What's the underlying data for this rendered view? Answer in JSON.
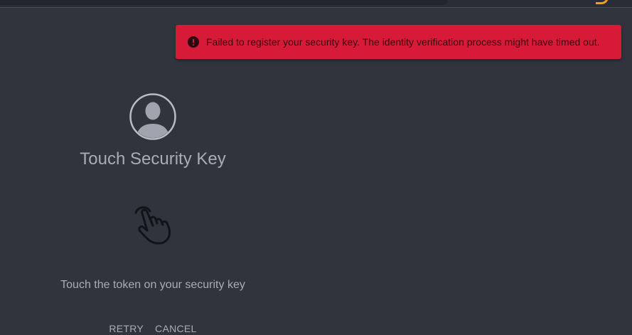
{
  "alert": {
    "icon": "error-circle-icon",
    "message": "Failed to register your security key. The identity verification process might have timed out.",
    "background": "#d71a37"
  },
  "panel": {
    "avatar_icon": "user-avatar-icon",
    "title": "Touch Security Key",
    "hand_icon": "touch-hand-icon",
    "instruction": "Touch the token on your security key",
    "retry_label": "RETRY",
    "cancel_label": "CANCEL"
  },
  "colors": {
    "background": "#31343d",
    "text": "#a7acb7",
    "accent": "#f0a020"
  }
}
